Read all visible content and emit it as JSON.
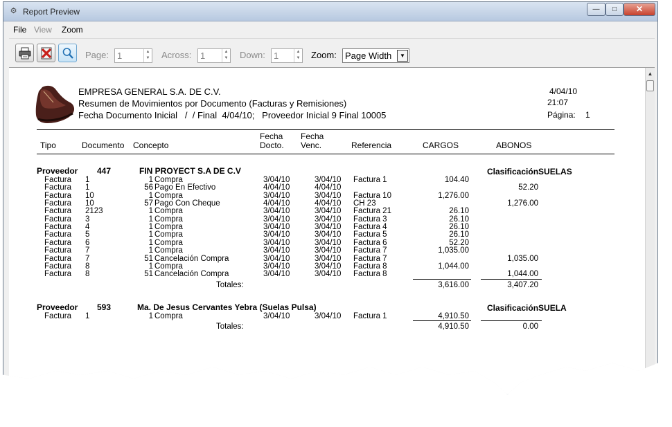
{
  "window": {
    "title": "Report Preview",
    "minimize": "—",
    "maximize": "□",
    "close": "✕"
  },
  "menu": {
    "file": "File",
    "view": "View",
    "zoom": "Zoom"
  },
  "toolbar": {
    "page_label": "Page:",
    "page_value": "1",
    "across_label": "Across:",
    "across_value": "1",
    "down_label": "Down:",
    "down_value": "1",
    "zoom_label": "Zoom:",
    "zoom_value": "Page Width",
    "icons": [
      "printer-icon",
      "close-preview-icon",
      "find-icon"
    ]
  },
  "report": {
    "company": "EMPRESA GENERAL S.A. DE C.V.",
    "subtitle": "Resumen de Movimientos por Documento (Facturas y Remisiones)",
    "params": "Fecha Documento Inicial   /  / Final  4/04/10;   Proveedor Inicial 9 Final 10005",
    "date": "4/04/10",
    "time": "21:07",
    "page_label": "Página:",
    "page_num": "1",
    "columns": {
      "tipo": "Tipo",
      "documento": "Documento",
      "concepto": "Concepto",
      "fecha_docto_1": "Fecha",
      "fecha_docto_2": "Docto.",
      "fecha_venc_1": "Fecha",
      "fecha_venc_2": "Venc.",
      "referencia": "Referencia",
      "cargos": "CARGOS",
      "abonos": "ABONOS"
    },
    "groups": [
      {
        "label": "Proveedor",
        "number": "447",
        "name": "FIN PROYECT S.A DE C.V",
        "clasificacion": "ClasificaciónSUELAS",
        "rows": [
          {
            "tipo": "Factura",
            "doc": "1",
            "cnum": "1",
            "concepto": "Compra",
            "fdoc": "3/04/10",
            "fven": "3/04/10",
            "ref": "Factura 1",
            "cargo": "104.40",
            "abono": ""
          },
          {
            "tipo": "Factura",
            "doc": "1",
            "cnum": "56",
            "concepto": "Pago En Efectivo",
            "fdoc": "4/04/10",
            "fven": "4/04/10",
            "ref": "",
            "cargo": "",
            "abono": "52.20"
          },
          {
            "tipo": "Factura",
            "doc": "10",
            "cnum": "1",
            "concepto": "Compra",
            "fdoc": "3/04/10",
            "fven": "3/04/10",
            "ref": "Factura 10",
            "cargo": "1,276.00",
            "abono": ""
          },
          {
            "tipo": "Factura",
            "doc": "10",
            "cnum": "57",
            "concepto": "Pago Con Cheque",
            "fdoc": "4/04/10",
            "fven": "4/04/10",
            "ref": "CH 23",
            "cargo": "",
            "abono": "1,276.00"
          },
          {
            "tipo": "Factura",
            "doc": "2123",
            "cnum": "1",
            "concepto": "Compra",
            "fdoc": "3/04/10",
            "fven": "3/04/10",
            "ref": "Factura 21",
            "cargo": "26.10",
            "abono": ""
          },
          {
            "tipo": "Factura",
            "doc": "3",
            "cnum": "1",
            "concepto": "Compra",
            "fdoc": "3/04/10",
            "fven": "3/04/10",
            "ref": "Factura 3",
            "cargo": "26.10",
            "abono": ""
          },
          {
            "tipo": "Factura",
            "doc": "4",
            "cnum": "1",
            "concepto": "Compra",
            "fdoc": "3/04/10",
            "fven": "3/04/10",
            "ref": "Factura 4",
            "cargo": "26.10",
            "abono": ""
          },
          {
            "tipo": "Factura",
            "doc": "5",
            "cnum": "1",
            "concepto": "Compra",
            "fdoc": "3/04/10",
            "fven": "3/04/10",
            "ref": "Factura 5",
            "cargo": "26.10",
            "abono": ""
          },
          {
            "tipo": "Factura",
            "doc": "6",
            "cnum": "1",
            "concepto": "Compra",
            "fdoc": "3/04/10",
            "fven": "3/04/10",
            "ref": "Factura 6",
            "cargo": "52.20",
            "abono": ""
          },
          {
            "tipo": "Factura",
            "doc": "7",
            "cnum": "1",
            "concepto": "Compra",
            "fdoc": "3/04/10",
            "fven": "3/04/10",
            "ref": "Factura 7",
            "cargo": "1,035.00",
            "abono": ""
          },
          {
            "tipo": "Factura",
            "doc": "7",
            "cnum": "51",
            "concepto": "Cancelación Compra",
            "fdoc": "3/04/10",
            "fven": "3/04/10",
            "ref": "Factura 7",
            "cargo": "",
            "abono": "1,035.00"
          },
          {
            "tipo": "Factura",
            "doc": "8",
            "cnum": "1",
            "concepto": "Compra",
            "fdoc": "3/04/10",
            "fven": "3/04/10",
            "ref": "Factura 8",
            "cargo": "1,044.00",
            "abono": ""
          },
          {
            "tipo": "Factura",
            "doc": "8",
            "cnum": "51",
            "concepto": "Cancelación Compra",
            "fdoc": "3/04/10",
            "fven": "3/04/10",
            "ref": "Factura 8",
            "cargo": "",
            "abono": "1,044.00"
          }
        ],
        "totals_label": "Totales:",
        "total_cargos": "3,616.00",
        "total_abonos": "3,407.20"
      },
      {
        "label": "Proveedor",
        "number": "593",
        "name": "Ma. De Jesus Cervantes Yebra (Suelas Pulsa)",
        "clasificacion": "ClasificaciónSUELA",
        "rows": [
          {
            "tipo": "Factura",
            "doc": "1",
            "cnum": "1",
            "concepto": "Compra",
            "fdoc": "3/04/10",
            "fven": "3/04/10",
            "ref": "Factura 1",
            "cargo": "4,910.50",
            "abono": ""
          }
        ],
        "totals_label": "Totales:",
        "total_cargos": "4,910.50",
        "total_abonos": "0.00"
      }
    ]
  },
  "colors": {
    "title_bar": "#c9d7ea",
    "close_button": "#c7412d",
    "window_bg": "#f0f0f0"
  }
}
